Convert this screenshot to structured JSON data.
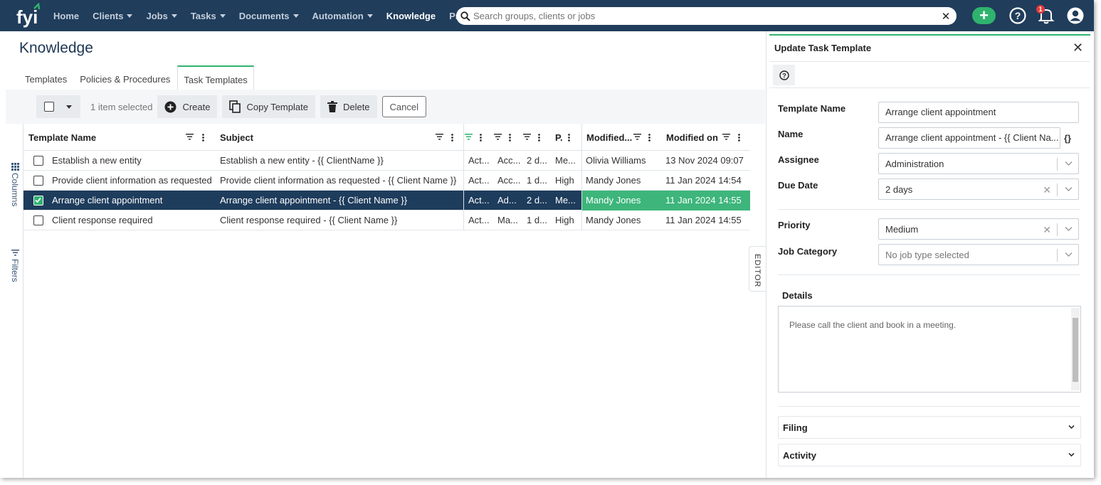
{
  "nav": {
    "logo_text": "fyi",
    "items": [
      {
        "label": "Home",
        "dropdown": false
      },
      {
        "label": "Clients",
        "dropdown": true
      },
      {
        "label": "Jobs",
        "dropdown": true
      },
      {
        "label": "Tasks",
        "dropdown": true
      },
      {
        "label": "Documents",
        "dropdown": true
      },
      {
        "label": "Automation",
        "dropdown": true
      },
      {
        "label": "Knowledge",
        "dropdown": false,
        "active": true
      },
      {
        "label": "Practice",
        "dropdown": false
      }
    ],
    "search_placeholder": "Search groups, clients or jobs",
    "notification_count": "1"
  },
  "page": {
    "title": "Knowledge",
    "tabs": [
      "Templates",
      "Policies & Procedures",
      "Task Templates"
    ],
    "active_tab": "Task Templates"
  },
  "toolbar": {
    "selected_count": "1 item selected",
    "create": "Create",
    "copy_template": "Copy Template",
    "delete": "Delete",
    "cancel": "Cancel"
  },
  "side_panel": {
    "columns": "Columns",
    "filters": "Filters"
  },
  "grid": {
    "headers": [
      "Template Name",
      "Subject",
      "",
      "",
      "",
      "P.",
      "Modified...",
      "Modified on"
    ],
    "rows": [
      {
        "name": "Establish a new entity",
        "subject": "Establish a new entity - {{ ClientName }}",
        "c3": "Act...",
        "c4": "Acc...",
        "c5": "2 d...",
        "c6": "Me...",
        "modified_by": "Olivia Williams",
        "modified_on": "13 Nov 2024 09:07",
        "selected": false
      },
      {
        "name": "Provide client information as requested",
        "subject": "Provide client information as requested - {{ Client Name }}",
        "c3": "Act...",
        "c4": "Acc...",
        "c5": "1 d...",
        "c6": "High",
        "modified_by": "Mandy Jones",
        "modified_on": "11 Jan 2024 14:54",
        "selected": false
      },
      {
        "name": "Arrange client appointment",
        "subject": "Arrange client appointment - {{ Client Name }}",
        "c3": "Act...",
        "c4": "Ad...",
        "c5": "2 d...",
        "c6": "Me...",
        "modified_by": "Mandy Jones",
        "modified_on": "11 Jan 2024 14:55",
        "selected": true
      },
      {
        "name": "Client response required",
        "subject": "Client response required - {{ Client Name }}",
        "c3": "Act...",
        "c4": "Ma...",
        "c5": "1 d...",
        "c6": "High",
        "modified_by": "Mandy Jones",
        "modified_on": "11 Jan 2024 14:55",
        "selected": false
      }
    ]
  },
  "editor_tab": "EDITOR",
  "form": {
    "title": "Update Task Template",
    "template_name_label": "Template Name",
    "template_name_value": "Arrange client appointment",
    "name_label": "Name",
    "name_value": "Arrange client appointment - {{ Client Na...",
    "assignee_label": "Assignee",
    "assignee_value": "Administration",
    "due_date_label": "Due Date",
    "due_date_value": "2 days",
    "priority_label": "Priority",
    "priority_value": "Medium",
    "job_category_label": "Job Category",
    "job_category_placeholder": "No job type selected",
    "details_label": "Details",
    "details_value": "Please call the client and book in a meeting.",
    "filing_label": "Filing",
    "activity_label": "Activity"
  },
  "colors": {
    "nav_bg": "#203d5b",
    "accent_green": "#2fb36e",
    "selected_row": "#1e3c5c",
    "selected_row_right": "#3db57b"
  }
}
